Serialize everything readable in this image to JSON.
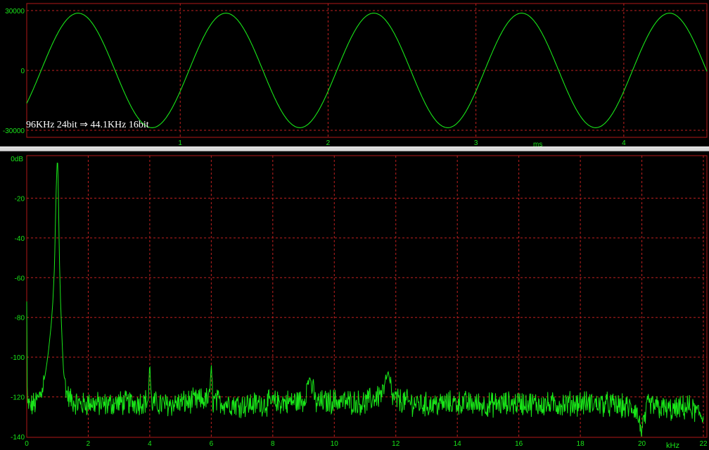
{
  "chart_data": [
    {
      "type": "line",
      "title": "96KHz 24bit ⇒ 44.1KHz 16bit",
      "xlabel": "ms",
      "ylabel": "",
      "xlim": [
        0,
        4.6
      ],
      "ylim": [
        -30000,
        30000
      ],
      "x_ticks": [
        1,
        2,
        3,
        4
      ],
      "x_tick_labels": [
        "1",
        "2",
        "3",
        "4"
      ],
      "y_ticks": [
        30000,
        0,
        -30000
      ],
      "y_tick_labels": [
        "30000",
        "0",
        "-30000"
      ],
      "grid": true,
      "series": [
        {
          "waveform": "sine",
          "frequency_hz": 1000,
          "amplitude": 28700,
          "phase_at_x0_deg": -35,
          "color": "#19e619"
        }
      ]
    },
    {
      "type": "line",
      "title": "",
      "xlabel": "kHz",
      "ylabel": "",
      "xlim": [
        0,
        22
      ],
      "ylim": [
        -140,
        0
      ],
      "x_ticks": [
        0,
        2,
        4,
        6,
        8,
        10,
        12,
        14,
        16,
        18,
        20,
        22
      ],
      "x_tick_labels": [
        "0",
        "2",
        "4",
        "6",
        "8",
        "10",
        "12",
        "14",
        "16",
        "18",
        "20",
        "22"
      ],
      "y_ticks": [
        0,
        -20,
        -40,
        -60,
        -80,
        -100,
        -120,
        -140
      ],
      "y_tick_labels": [
        "0dB",
        "-20",
        "-40",
        "-60",
        "-80",
        "-100",
        "-120",
        "-140"
      ],
      "grid": true,
      "series": [
        {
          "name": "",
          "color": "#19e619",
          "noise_floor_db": -123,
          "noise_spread_db": 7,
          "x": [
            0,
            0.02,
            0.05,
            0.1,
            0.2,
            0.3,
            0.4,
            0.5,
            0.6,
            0.7,
            0.8,
            0.85,
            0.9,
            0.93,
            0.96,
            0.98,
            0.995,
            1.0,
            1.005,
            1.02,
            1.04,
            1.07,
            1.1,
            1.15,
            1.2,
            1.3,
            1.4,
            1.5,
            1.6,
            1.8,
            2.0,
            2.5,
            3.0,
            3.5,
            3.95,
            4.0,
            4.05,
            4.5,
            5.0,
            5.5,
            5.95,
            6.0,
            6.05,
            6.5,
            7.0,
            8.0,
            9.0,
            9.2,
            9.4,
            10.0,
            11.0,
            11.6,
            11.75,
            11.9,
            12.5,
            13.0,
            14.0,
            15.0,
            16.0,
            17.0,
            18.0,
            19.0,
            19.8,
            20.0,
            20.2,
            21.0,
            21.5,
            22.0
          ],
          "values": [
            -72,
            -128,
            -123,
            -125,
            -124,
            -123,
            -120,
            -116,
            -109,
            -98,
            -83,
            -72,
            -55,
            -35,
            -15,
            -5,
            -1,
            0,
            -2,
            -10,
            -30,
            -55,
            -72,
            -92,
            -108,
            -118,
            -121,
            -122,
            -123,
            -124,
            -123,
            -124,
            -123,
            -123,
            -122,
            -102,
            -123,
            -124,
            -123,
            -122,
            -121,
            -103,
            -122,
            -123,
            -124,
            -123,
            -122,
            -110,
            -123,
            -122,
            -123,
            -118,
            -107,
            -121,
            -123,
            -124,
            -123,
            -124,
            -123,
            -124,
            -123,
            -124,
            -126,
            -138,
            -124,
            -127,
            -125,
            -130
          ]
        }
      ]
    }
  ]
}
